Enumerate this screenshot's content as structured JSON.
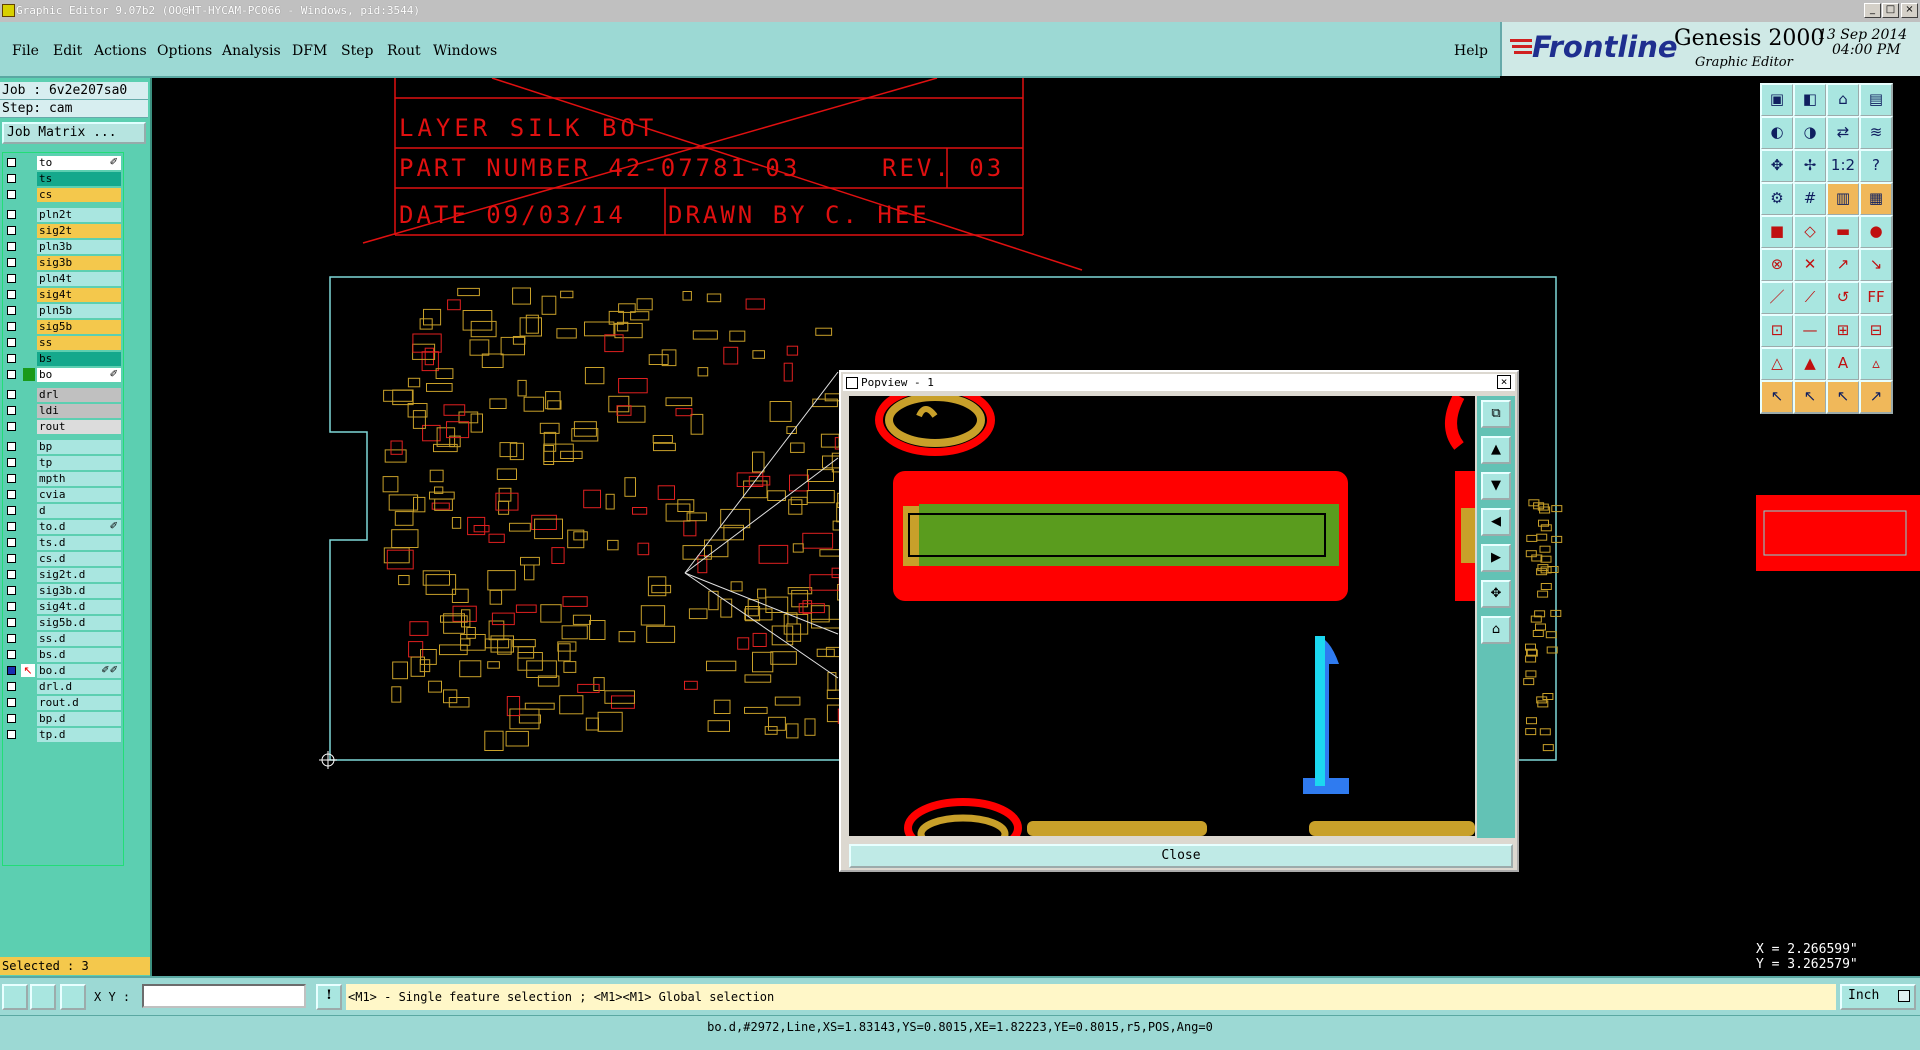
{
  "window": {
    "title": "Graphic Editor 9.07b2 (OO@HT-HYCAM-PC066 - Windows, pid:3544)"
  },
  "menu": {
    "items": [
      "File",
      "Edit",
      "Actions",
      "Options",
      "Analysis",
      "DFM",
      "Step",
      "Rout",
      "Windows"
    ],
    "help": "Help"
  },
  "brand": {
    "logo": "Frontline",
    "product": "Genesis 2000",
    "subtitle": "Graphic Editor",
    "date": "13 Sep 2014",
    "time": "04:00 PM"
  },
  "job": {
    "job_label": "Job : 6v2e207sa0",
    "step_label": "Step: cam",
    "matrix_button": "Job Matrix ..."
  },
  "layers": [
    {
      "name": "to",
      "color": "#ffffff",
      "mark": "✐"
    },
    {
      "name": "ts",
      "color": "#14a88c"
    },
    {
      "name": "cs",
      "color": "#f4c84c"
    },
    {
      "name": "pln2t",
      "color": "#a9e6e0"
    },
    {
      "name": "sig2t",
      "color": "#f4c84c"
    },
    {
      "name": "pln3b",
      "color": "#a9e6e0"
    },
    {
      "name": "sig3b",
      "color": "#f4c84c"
    },
    {
      "name": "pln4t",
      "color": "#a9e6e0"
    },
    {
      "name": "sig4t",
      "color": "#f4c84c"
    },
    {
      "name": "pln5b",
      "color": "#a9e6e0"
    },
    {
      "name": "sig5b",
      "color": "#f4c84c"
    },
    {
      "name": "ss",
      "color": "#f4c84c"
    },
    {
      "name": "bs",
      "color": "#14a88c"
    },
    {
      "name": "bo",
      "color": "#ffffff",
      "mark": "✐",
      "active": true
    },
    {
      "name": "drl",
      "color": "#c0c0c0"
    },
    {
      "name": "ldi",
      "color": "#c0c0c0"
    },
    {
      "name": "rout",
      "color": "#dcdcdc"
    },
    {
      "name": "bp",
      "color": "#a9e6e0"
    },
    {
      "name": "tp",
      "color": "#a9e6e0"
    },
    {
      "name": "mpth",
      "color": "#a9e6e0"
    },
    {
      "name": "cvia",
      "color": "#a9e6e0"
    },
    {
      "name": "d",
      "color": "#a9e6e0"
    },
    {
      "name": "to.d",
      "color": "#a9e6e0",
      "mark": "✐"
    },
    {
      "name": "ts.d",
      "color": "#a9e6e0"
    },
    {
      "name": "cs.d",
      "color": "#a9e6e0"
    },
    {
      "name": "sig2t.d",
      "color": "#a9e6e0"
    },
    {
      "name": "sig3b.d",
      "color": "#a9e6e0"
    },
    {
      "name": "sig4t.d",
      "color": "#a9e6e0"
    },
    {
      "name": "sig5b.d",
      "color": "#a9e6e0"
    },
    {
      "name": "ss.d",
      "color": "#a9e6e0"
    },
    {
      "name": "bs.d",
      "color": "#a9e6e0"
    },
    {
      "name": "bo.d",
      "color": "#a9e6e0",
      "mark": "✐✐",
      "work": true
    },
    {
      "name": "drl.d",
      "color": "#a9e6e0"
    },
    {
      "name": "rout.d",
      "color": "#a9e6e0"
    },
    {
      "name": "bp.d",
      "color": "#a9e6e0"
    },
    {
      "name": "tp.d",
      "color": "#a9e6e0"
    }
  ],
  "selected": "Selected : 3",
  "title_block": {
    "layer": "LAYER  SILK BOT",
    "part": "PART NUMBER   42-07781-03",
    "rev": "REV.  03",
    "date": "DATE 09/03/14",
    "drawn": "DRAWN BY  C. HEE"
  },
  "popview": {
    "title": "Popview - 1",
    "close": "Close"
  },
  "coords": {
    "x": "X = 2.266599\"",
    "y": "Y = 3.262579\""
  },
  "bottom": {
    "xy_label": "X Y :",
    "xy_value": "",
    "hint": "<M1> - Single feature selection ; <M1><M1> Global selection",
    "units": "Inch"
  },
  "status": "bo.d,#2972,Line,XS=1.83143,YS=0.8015,XE=1.82223,YE=0.8015,r5,POS,Ang=0",
  "colors": {
    "teal": "#9cd9d4",
    "layer_active": "#f4c84c",
    "red_feature": "#ff0000",
    "green_feature": "#5a9c1e"
  }
}
